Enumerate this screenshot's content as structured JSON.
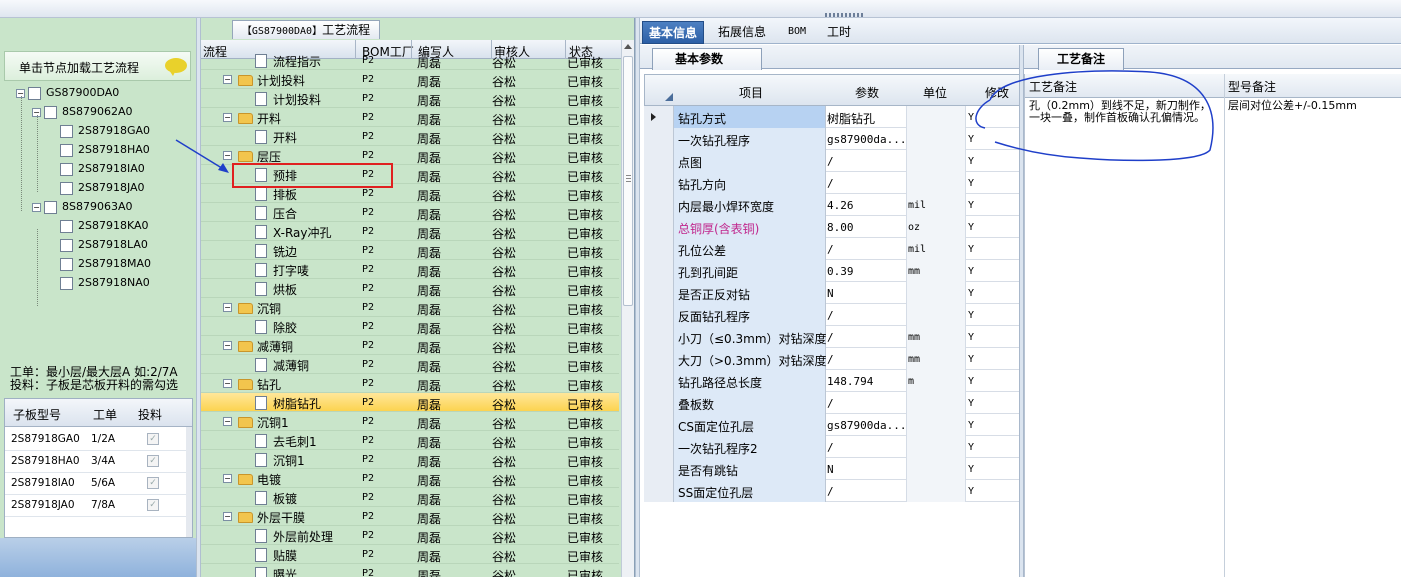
{
  "left_panel": {
    "load_header": "单击节点加载工艺流程",
    "tree": [
      {
        "label": "GS87900DA0",
        "level": 0
      },
      {
        "label": "8S879062A0",
        "level": 1
      },
      {
        "label": "2S87918GA0",
        "level": 2
      },
      {
        "label": "2S87918HA0",
        "level": 2
      },
      {
        "label": "2S87918IA0",
        "level": 2
      },
      {
        "label": "2S87918JA0",
        "level": 2
      },
      {
        "label": "8S879063A0",
        "level": 1
      },
      {
        "label": "2S87918KA0",
        "level": 2
      },
      {
        "label": "2S87918LA0",
        "level": 2
      },
      {
        "label": "2S87918MA0",
        "level": 2
      },
      {
        "label": "2S87918NA0",
        "level": 2
      }
    ],
    "note_line1": "工单：最小层/最大层A 如:2/7A",
    "note_line2": "投料：子板是芯板开料的需勾选",
    "subgrid": {
      "headers": [
        "子板型号",
        "工单",
        "投料"
      ],
      "rows": [
        {
          "model": "2S87918GA0",
          "order": "1/2A",
          "feed": "✓"
        },
        {
          "model": "2S87918HA0",
          "order": "3/4A",
          "feed": "✓"
        },
        {
          "model": "2S87918IA0",
          "order": "5/6A",
          "feed": "✓"
        },
        {
          "model": "2S87918JA0",
          "order": "7/8A",
          "feed": "✓"
        }
      ]
    }
  },
  "mid_panel": {
    "title_code": "【GS87900DA0】",
    "title_text": "工艺流程",
    "headers": [
      "流程",
      "BOM工厂",
      "编写人",
      "审核人",
      "状态"
    ],
    "rows": [
      {
        "name": "流程指示",
        "type": "doc",
        "factory": "P2",
        "writer": "周磊",
        "reviewer": "谷松",
        "status": "已审核"
      },
      {
        "name": "计划投料",
        "type": "folder",
        "factory": "P2",
        "writer": "周磊",
        "reviewer": "谷松",
        "status": "已审核"
      },
      {
        "name": "计划投料",
        "type": "doc",
        "factory": "P2",
        "writer": "周磊",
        "reviewer": "谷松",
        "status": "已审核"
      },
      {
        "name": "开料",
        "type": "folder",
        "factory": "P2",
        "writer": "周磊",
        "reviewer": "谷松",
        "status": "已审核"
      },
      {
        "name": "开料",
        "type": "doc",
        "factory": "P2",
        "writer": "周磊",
        "reviewer": "谷松",
        "status": "已审核"
      },
      {
        "name": "层压",
        "type": "folder",
        "factory": "P2",
        "writer": "周磊",
        "reviewer": "谷松",
        "status": "已审核"
      },
      {
        "name": "预排",
        "type": "doc",
        "factory": "P2",
        "writer": "周磊",
        "reviewer": "谷松",
        "status": "已审核"
      },
      {
        "name": "排板",
        "type": "doc",
        "factory": "P2",
        "writer": "周磊",
        "reviewer": "谷松",
        "status": "已审核"
      },
      {
        "name": "压合",
        "type": "doc",
        "factory": "P2",
        "writer": "周磊",
        "reviewer": "谷松",
        "status": "已审核"
      },
      {
        "name": "X-Ray冲孔",
        "type": "doc",
        "factory": "P2",
        "writer": "周磊",
        "reviewer": "谷松",
        "status": "已审核"
      },
      {
        "name": "铣边",
        "type": "doc",
        "factory": "P2",
        "writer": "周磊",
        "reviewer": "谷松",
        "status": "已审核"
      },
      {
        "name": "打字唛",
        "type": "doc",
        "factory": "P2",
        "writer": "周磊",
        "reviewer": "谷松",
        "status": "已审核"
      },
      {
        "name": "烘板",
        "type": "doc",
        "factory": "P2",
        "writer": "周磊",
        "reviewer": "谷松",
        "status": "已审核"
      },
      {
        "name": "沉铜",
        "type": "folder",
        "factory": "P2",
        "writer": "周磊",
        "reviewer": "谷松",
        "status": "已审核"
      },
      {
        "name": "除胶",
        "type": "doc",
        "factory": "P2",
        "writer": "周磊",
        "reviewer": "谷松",
        "status": "已审核"
      },
      {
        "name": "减薄铜",
        "type": "folder",
        "factory": "P2",
        "writer": "周磊",
        "reviewer": "谷松",
        "status": "已审核"
      },
      {
        "name": "减薄铜",
        "type": "doc",
        "factory": "P2",
        "writer": "周磊",
        "reviewer": "谷松",
        "status": "已审核"
      },
      {
        "name": "钻孔",
        "type": "folder",
        "factory": "P2",
        "writer": "周磊",
        "reviewer": "谷松",
        "status": "已审核"
      },
      {
        "name": "树脂钻孔",
        "type": "doc",
        "factory": "P2",
        "writer": "周磊",
        "reviewer": "谷松",
        "status": "已审核",
        "selected": true
      },
      {
        "name": "沉铜1",
        "type": "folder",
        "factory": "P2",
        "writer": "周磊",
        "reviewer": "谷松",
        "status": "已审核"
      },
      {
        "name": "去毛刺1",
        "type": "doc",
        "factory": "P2",
        "writer": "周磊",
        "reviewer": "谷松",
        "status": "已审核"
      },
      {
        "name": "沉铜1",
        "type": "doc",
        "factory": "P2",
        "writer": "周磊",
        "reviewer": "谷松",
        "status": "已审核"
      },
      {
        "name": "电镀",
        "type": "folder",
        "factory": "P2",
        "writer": "周磊",
        "reviewer": "谷松",
        "status": "已审核"
      },
      {
        "name": "板镀",
        "type": "doc",
        "factory": "P2",
        "writer": "周磊",
        "reviewer": "谷松",
        "status": "已审核"
      },
      {
        "name": "外层干膜",
        "type": "folder",
        "factory": "P2",
        "writer": "周磊",
        "reviewer": "谷松",
        "status": "已审核"
      },
      {
        "name": "外层前处理",
        "type": "doc",
        "factory": "P2",
        "writer": "周磊",
        "reviewer": "谷松",
        "status": "已审核"
      },
      {
        "name": "贴膜",
        "type": "doc",
        "factory": "P2",
        "writer": "周磊",
        "reviewer": "谷松",
        "status": "已审核"
      },
      {
        "name": "曝光",
        "type": "doc",
        "factory": "P2",
        "writer": "周磊",
        "reviewer": "谷松",
        "status": "已审核"
      }
    ]
  },
  "right_panel": {
    "tabs": [
      "基本信息",
      "拓展信息",
      "BOM",
      "工时"
    ],
    "subtab": "基本参数",
    "param_headers": [
      "项目",
      "参数",
      "单位",
      "修改"
    ],
    "params": [
      {
        "item": "钻孔方式",
        "value": "树脂钻孔",
        "unit": "",
        "mod": "Y"
      },
      {
        "item": "一次钻孔程序",
        "value": "gs87900da...",
        "unit": "",
        "mod": "Y"
      },
      {
        "item": "点图",
        "value": "/",
        "unit": "",
        "mod": "Y"
      },
      {
        "item": "钻孔方向",
        "value": "/",
        "unit": "",
        "mod": "Y"
      },
      {
        "item": "内层最小焊环宽度",
        "value": "4.26",
        "unit": "mil",
        "mod": "Y"
      },
      {
        "item": "总铜厚(含表铜)",
        "value": "8.00",
        "unit": "oz",
        "mod": "Y",
        "highlight": true
      },
      {
        "item": "孔位公差",
        "value": "/",
        "unit": "mil",
        "mod": "Y"
      },
      {
        "item": "孔到孔间距",
        "value": "0.39",
        "unit": "mm",
        "mod": "Y"
      },
      {
        "item": "是否正反对钻",
        "value": "N",
        "unit": "",
        "mod": "Y"
      },
      {
        "item": "反面钻孔程序",
        "value": "/",
        "unit": "",
        "mod": "Y"
      },
      {
        "item": "小刀（≤0.3mm）对钻深度",
        "value": "/",
        "unit": "mm",
        "mod": "Y"
      },
      {
        "item": "大刀（>0.3mm）对钻深度",
        "value": "/",
        "unit": "mm",
        "mod": "Y"
      },
      {
        "item": "钻孔路径总长度",
        "value": "148.794",
        "unit": "m",
        "mod": "Y"
      },
      {
        "item": "叠板数",
        "value": "/",
        "unit": "",
        "mod": "Y"
      },
      {
        "item": "CS面定位孔层",
        "value": "gs87900da...",
        "unit": "",
        "mod": "Y"
      },
      {
        "item": "一次钻孔程序2",
        "value": "/",
        "unit": "",
        "mod": "Y"
      },
      {
        "item": "是否有跳钻",
        "value": "N",
        "unit": "",
        "mod": "Y"
      },
      {
        "item": "SS面定位孔层",
        "value": "/",
        "unit": "",
        "mod": "Y"
      }
    ],
    "notes_tab": "工艺备注",
    "notes_headers": [
      "工艺备注",
      "型号备注"
    ],
    "process_note": "孔（0.2mm）到线不足，新刀制作，一块一叠，制作首板确认孔偏情况。",
    "model_note": "层间对位公差+/-0.15mm"
  },
  "colors": {
    "panel_green": "#c9e5ca",
    "tab_active": "#2c5fa6",
    "selected_row": "#fcd350",
    "annotation_red": "#e02020",
    "annotation_blue": "#1f3fc9"
  }
}
